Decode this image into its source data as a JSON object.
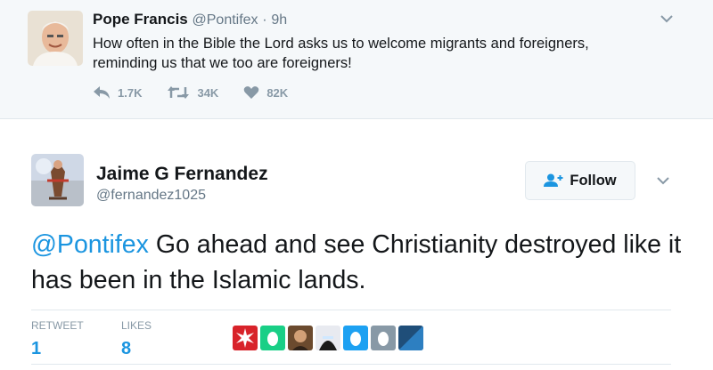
{
  "tweet1": {
    "name": "Pope Francis",
    "handle": "@Pontifex",
    "separator": "·",
    "time": "9h",
    "text_line1": "How often in the Bible the Lord asks us to welcome migrants and foreigners,",
    "text_line2": "reminding us that we too are foreigners!",
    "actions": {
      "reply_count": "1.7K",
      "retweet_count": "34K",
      "like_count": "82K"
    }
  },
  "tweet2": {
    "name": "Jaime G Fernandez",
    "handle": "@fernandez1025",
    "follow_label": "Follow",
    "mention": "@Pontifex",
    "text": " Go ahead and see Christianity destroyed like it has been in the Islamic lands.",
    "stats": {
      "retweet_label": "RETWEET",
      "retweet_value": "1",
      "likes_label": "LIKES",
      "likes_value": "8"
    },
    "liker_avatars": [
      "red-starburst",
      "green-egg",
      "portrait",
      "masked-figure",
      "blue-egg",
      "gray-egg",
      "blue-square"
    ]
  },
  "colors": {
    "accent": "#1b95e0",
    "muted": "#657786",
    "top_bg": "#f5f8fa"
  }
}
